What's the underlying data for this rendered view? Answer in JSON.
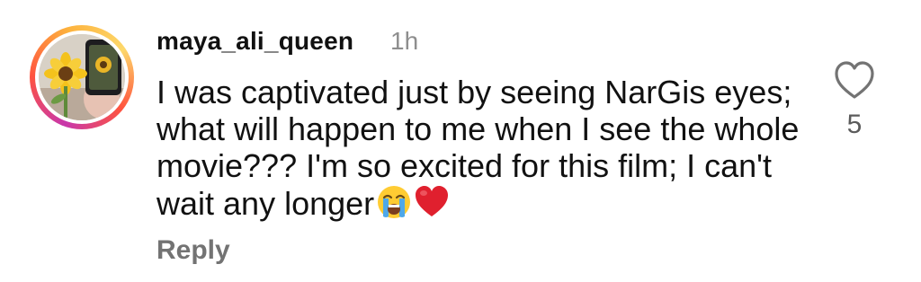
{
  "comment": {
    "username": "maya_ali_queen",
    "time": "1h",
    "text": "I was captivated just by seeing NarGis eyes; what will happen to me when I see the whole movie??? I'm so excited for this film; I can't wait any longer",
    "emojis": [
      "loudly-crying-face-emoji",
      "red-heart-emoji"
    ],
    "reply_label": "Reply",
    "like_count": "5",
    "like_icon": "heart-outline-icon"
  },
  "colors": {
    "ring_gradient": [
      "#c837ab",
      "#ff543e",
      "#fdb23d",
      "#fdd86b"
    ],
    "username": "#111111",
    "muted": "#8e8e8e",
    "reply": "#737373",
    "heart_emoji": "#e0202e"
  }
}
